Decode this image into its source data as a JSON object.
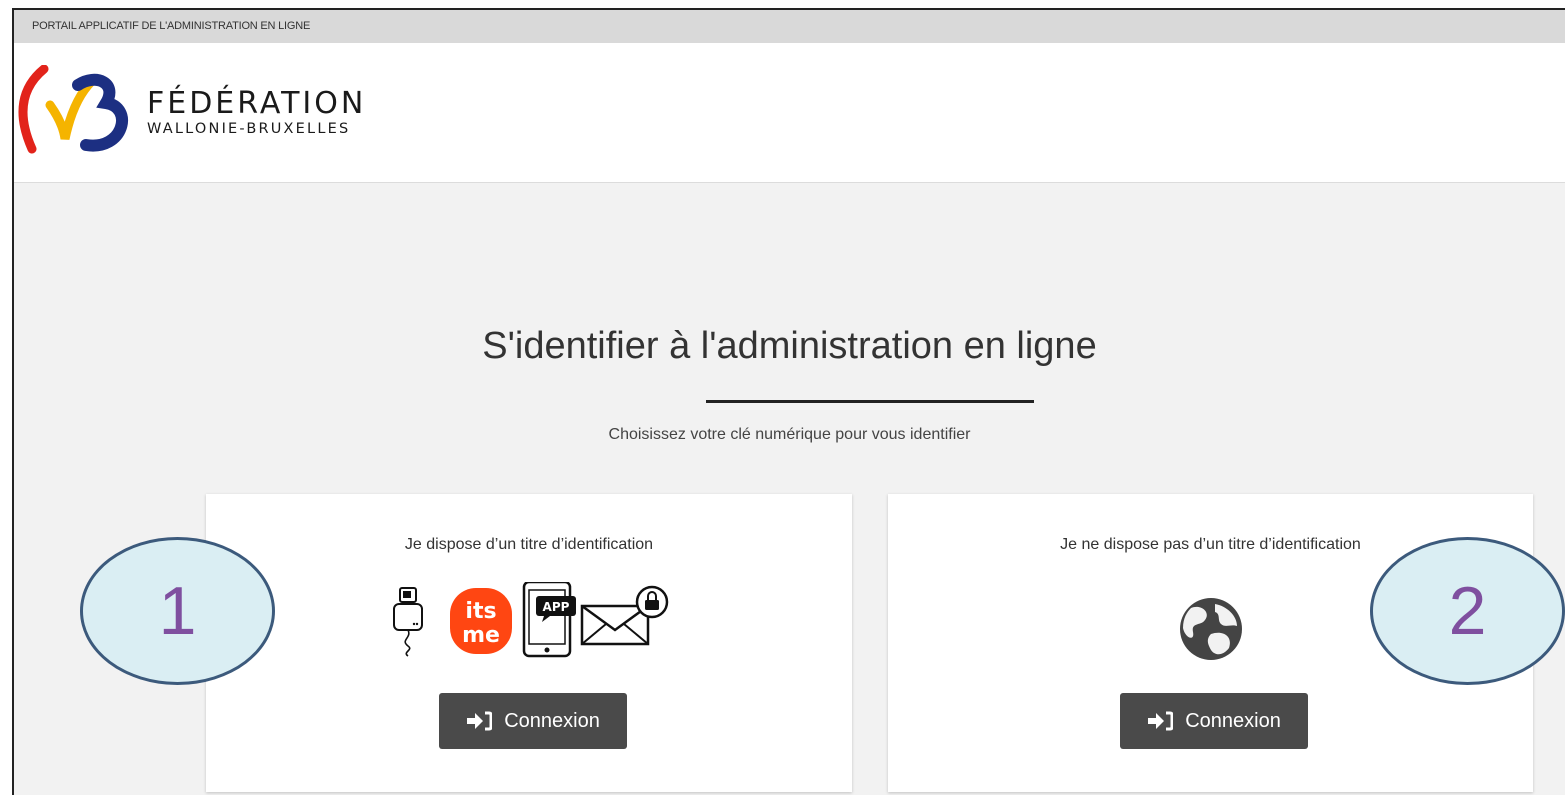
{
  "topbar": {
    "text": "PORTAIL APPLICATIF DE L'ADMINISTRATION EN LIGNE"
  },
  "brand": {
    "name": "FÉDÉRATION",
    "sub": "WALLONIE-BRUXELLES"
  },
  "main": {
    "title": "S'identifier à l'administration en ligne",
    "subtitle": "Choisissez votre clé numérique pour vous identifier"
  },
  "cards": [
    {
      "title": "Je dispose d’un titre d’identification",
      "icons": [
        "card-reader-icon",
        "itsme-icon",
        "mobile-app-icon",
        "secure-mail-icon"
      ],
      "itsme_label_1": "its",
      "itsme_label_2": "me",
      "app_label": "APP",
      "button": "Connexion"
    },
    {
      "title": "Je ne dispose pas d’un titre d’identification",
      "icons": [
        "globe-icon"
      ],
      "button": "Connexion"
    }
  ],
  "annotations": [
    {
      "label": "1"
    },
    {
      "label": "2"
    }
  ],
  "colors": {
    "itsme": "#ff4612",
    "button": "#4a4a4a",
    "oval_fill": "#daeef3",
    "oval_border": "#3c5a7c",
    "oval_text": "#7f4f9f"
  }
}
